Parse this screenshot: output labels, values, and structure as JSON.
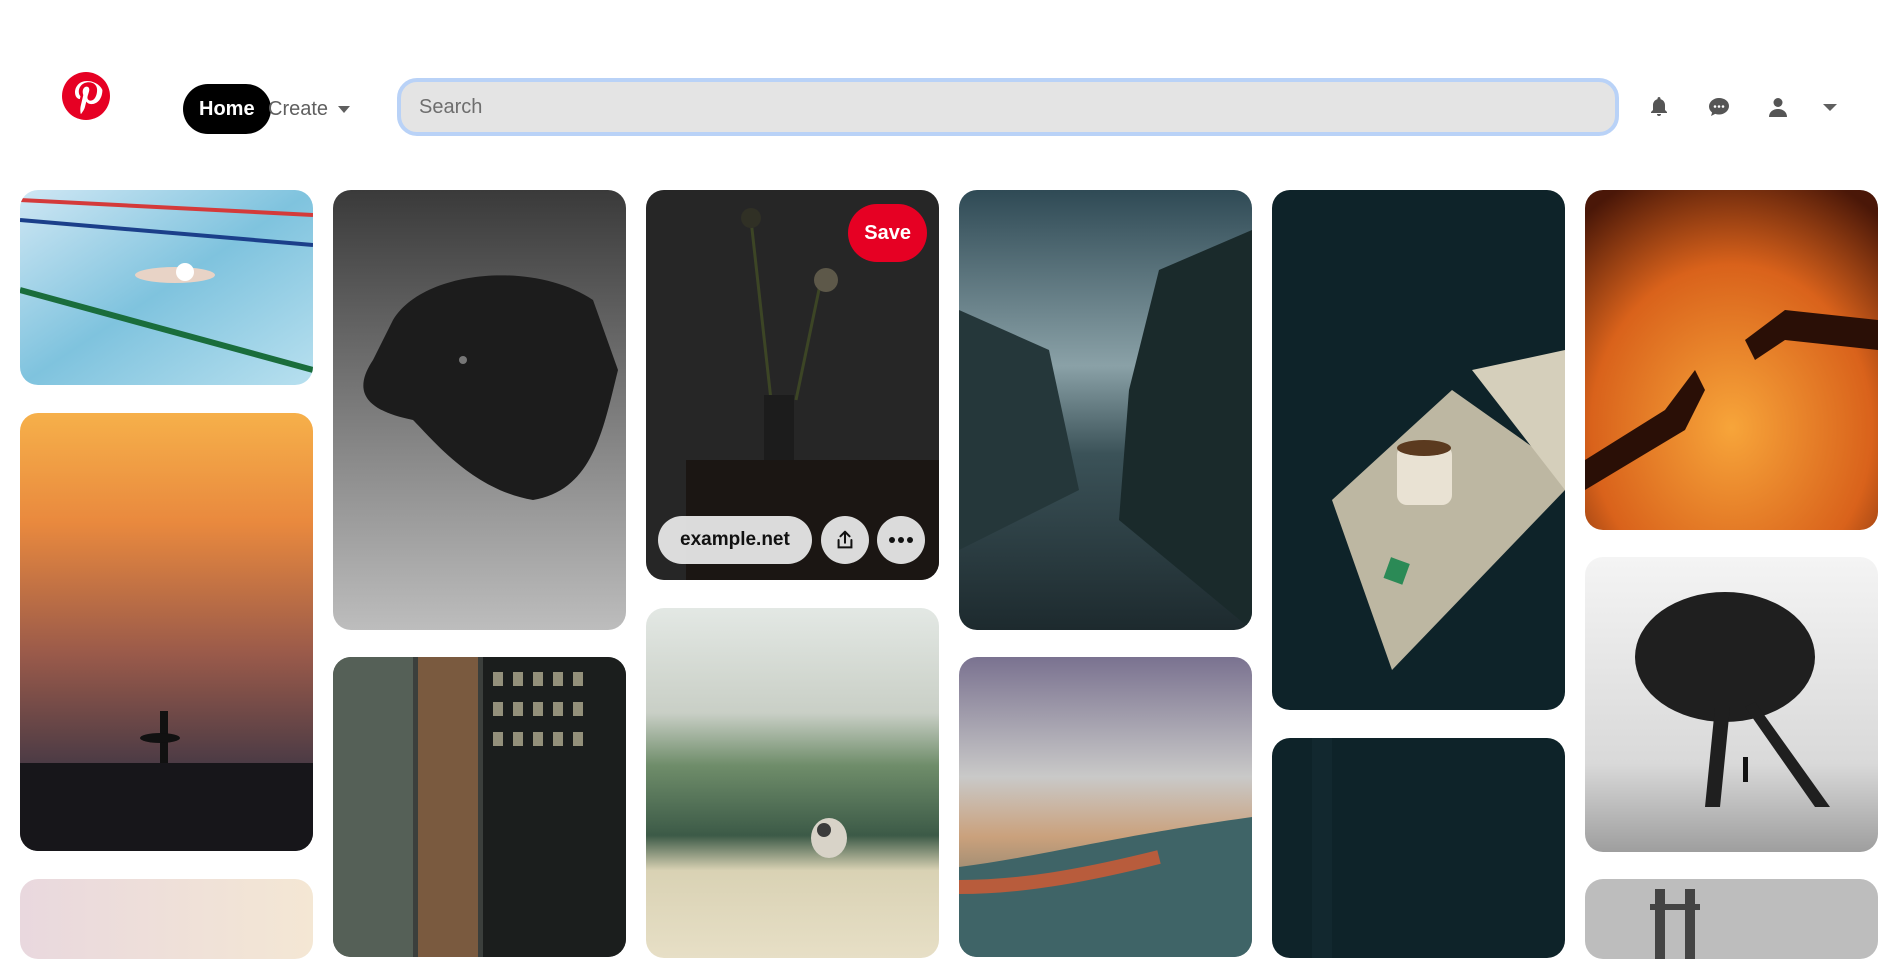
{
  "header": {
    "home_label": "Home",
    "create_label": "Create",
    "search_placeholder": "Search"
  },
  "icons": {
    "logo": "pinterest-logo",
    "notifications": "bell-icon",
    "messages": "chat-bubble-icon",
    "profile": "user-icon",
    "profile_menu": "chevron-down-icon",
    "share": "share-icon",
    "more": "more-options-icon"
  },
  "hovered_pin": {
    "save_label": "Save",
    "source_link": "example.net"
  },
  "colors": {
    "brand_red": "#e60023",
    "home_bg": "#000000",
    "search_bg": "#e4e4e4",
    "search_border": "#b9d2f7"
  }
}
